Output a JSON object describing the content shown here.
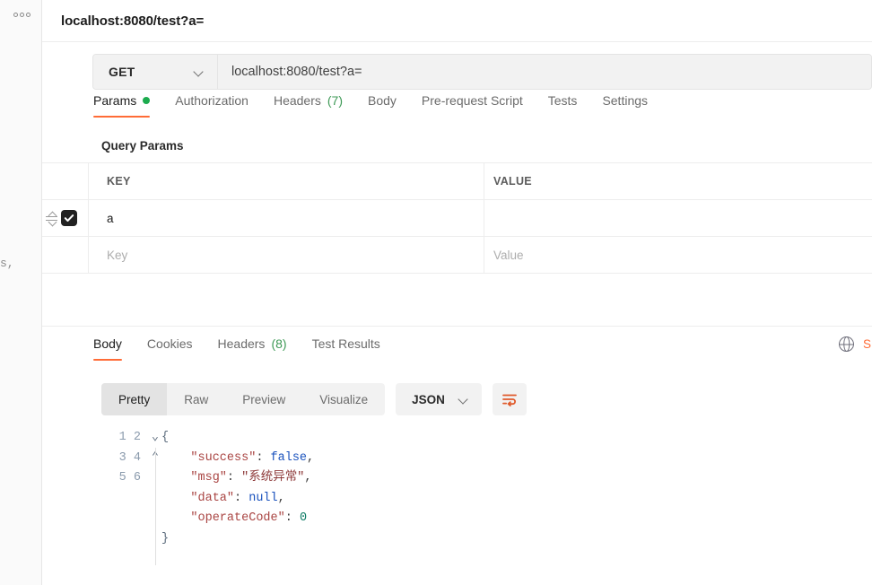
{
  "sidebar": {
    "more_icon": "more-horizontal-icon",
    "ghost_fragment": "s,"
  },
  "request": {
    "title": "localhost:8080/test?a=",
    "method": "GET",
    "url": "localhost:8080/test?a=",
    "method_caret_icon": "chevron-down-icon"
  },
  "request_tabs": [
    {
      "label": "Params",
      "badge": "",
      "dot": true,
      "active": true
    },
    {
      "label": "Authorization",
      "badge": "",
      "dot": false,
      "active": false
    },
    {
      "label": "Headers",
      "badge": "(7)",
      "dot": false,
      "active": false
    },
    {
      "label": "Body",
      "badge": "",
      "dot": false,
      "active": false
    },
    {
      "label": "Pre-request Script",
      "badge": "",
      "dot": false,
      "active": false
    },
    {
      "label": "Tests",
      "badge": "",
      "dot": false,
      "active": false
    },
    {
      "label": "Settings",
      "badge": "",
      "dot": false,
      "active": false
    }
  ],
  "query_params": {
    "heading": "Query Params",
    "columns": {
      "key": "KEY",
      "value": "VALUE"
    },
    "rows": [
      {
        "checked": true,
        "key": "a",
        "value": "",
        "placeholder_key": "",
        "placeholder_value": ""
      }
    ],
    "empty_row": {
      "placeholder_key": "Key",
      "placeholder_value": "Value"
    },
    "drag_icon": "drag-handle-icon",
    "checkbox_icon": "checkmark-icon"
  },
  "response": {
    "tabs": [
      {
        "label": "Body",
        "badge": "",
        "active": true
      },
      {
        "label": "Cookies",
        "badge": "",
        "active": false
      },
      {
        "label": "Headers",
        "badge": "(8)",
        "active": false
      },
      {
        "label": "Test Results",
        "badge": "",
        "active": false
      }
    ],
    "globe_icon": "globe-icon",
    "save_label": "S",
    "view_modes": [
      {
        "label": "Pretty",
        "active": true
      },
      {
        "label": "Raw",
        "active": false
      },
      {
        "label": "Preview",
        "active": false
      },
      {
        "label": "Visualize",
        "active": false
      }
    ],
    "format": "JSON",
    "format_caret_icon": "chevron-down-icon",
    "wrap_icon": "word-wrap-icon"
  },
  "code": {
    "line_numbers": [
      "1",
      "2",
      "3",
      "4",
      "5",
      "6"
    ],
    "raw": "{\n    \"success\": false,\n    \"msg\": \"系统异常\",\n    \"data\": null,\n    \"operateCode\": 0\n}",
    "tokens": {
      "l1": "{",
      "l2_key": "\"success\"",
      "l2_val": "false",
      "l3_key": "\"msg\"",
      "l3_val": "\"系统异常\"",
      "l4_key": "\"data\"",
      "l4_val": "null",
      "l5_key": "\"operateCode\"",
      "l5_val": "0",
      "l6": "}"
    },
    "fold_open": "⌄",
    "fold_close": "⌃"
  },
  "colors": {
    "accent": "#ff6c37",
    "status_green": "#1cab4e",
    "panel_bg": "#f2f2f2",
    "border": "#ededed",
    "json_blue": "#1a52bd",
    "json_key": "#a94442",
    "json_string": "#8e3a3a",
    "json_number": "#0b7a63"
  }
}
